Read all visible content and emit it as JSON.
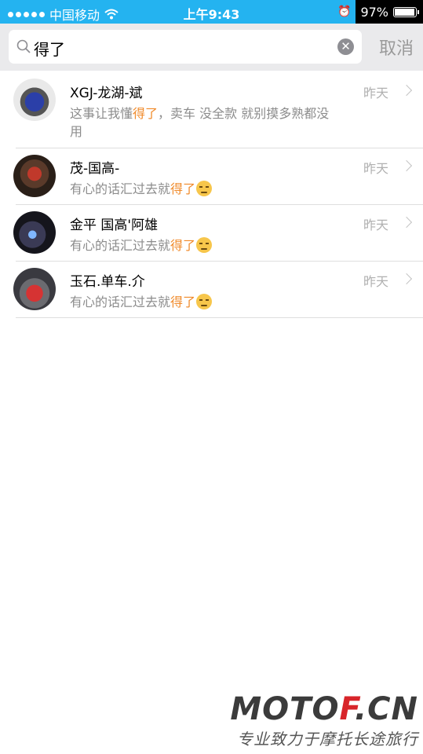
{
  "status_bar": {
    "carrier": "中国移动",
    "time": "上午9:43",
    "battery": "97%",
    "battery_level": 0.97
  },
  "search": {
    "query": "得了",
    "cancel_label": "取消"
  },
  "results": [
    {
      "name": "XGJ-龙湖-斌",
      "date": "昨天",
      "msg_before": "这事让我懂",
      "msg_match": "得了",
      "msg_after": "，卖车  没全款  就别摸多熟都没用",
      "emoji": false
    },
    {
      "name": "茂-国高-",
      "date": "昨天",
      "msg_before": "有心的话汇过去就",
      "msg_match": "得了",
      "msg_after": "",
      "emoji": true
    },
    {
      "name": "金平 国高'阿雄",
      "date": "昨天",
      "msg_before": "有心的话汇过去就",
      "msg_match": "得了",
      "msg_after": "",
      "emoji": true
    },
    {
      "name": "玉石.单车.介",
      "date": "昨天",
      "msg_before": "有心的话汇过去就",
      "msg_match": "得了",
      "msg_after": "",
      "emoji": true
    }
  ],
  "watermark": {
    "logo_main": "MOTO",
    "logo_accent": "F",
    "logo_tail": ".CN",
    "slogan": "专业致力于摩托长途旅行"
  }
}
